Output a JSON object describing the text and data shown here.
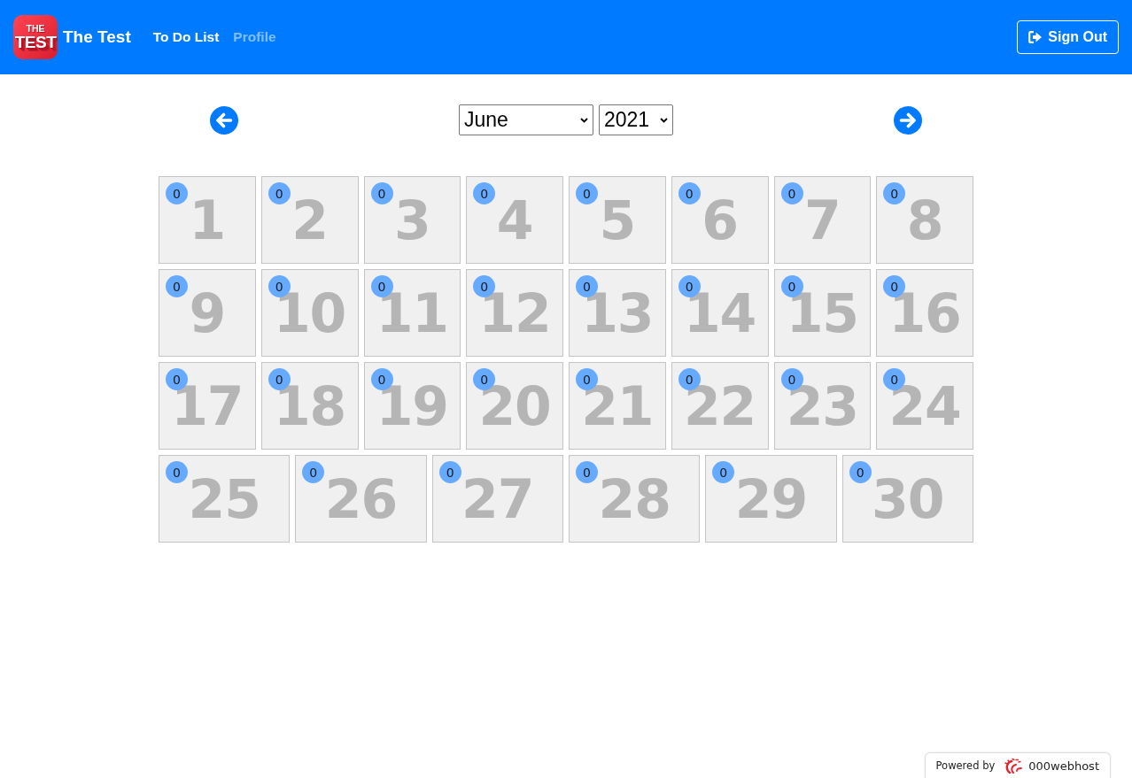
{
  "navbar": {
    "logo": {
      "top_text": "THE",
      "bottom_text": "TEST"
    },
    "title": "The Test",
    "links": [
      {
        "label": "To Do List",
        "selected": true
      },
      {
        "label": "Profile",
        "selected": false
      }
    ],
    "sign_out_button": {
      "label": "Sign Out"
    }
  },
  "month_nav": {
    "month_select": {
      "value": "June"
    },
    "year_select": {
      "value": "2021"
    }
  },
  "days": [
    {
      "day": "1",
      "count": "0"
    },
    {
      "day": "2",
      "count": "0"
    },
    {
      "day": "3",
      "count": "0"
    },
    {
      "day": "4",
      "count": "0"
    },
    {
      "day": "5",
      "count": "0"
    },
    {
      "day": "6",
      "count": "0"
    },
    {
      "day": "7",
      "count": "0"
    },
    {
      "day": "8",
      "count": "0"
    },
    {
      "day": "9",
      "count": "0"
    },
    {
      "day": "10",
      "count": "0"
    },
    {
      "day": "11",
      "count": "0"
    },
    {
      "day": "12",
      "count": "0"
    },
    {
      "day": "13",
      "count": "0"
    },
    {
      "day": "14",
      "count": "0"
    },
    {
      "day": "15",
      "count": "0"
    },
    {
      "day": "16",
      "count": "0"
    },
    {
      "day": "17",
      "count": "0"
    },
    {
      "day": "18",
      "count": "0"
    },
    {
      "day": "19",
      "count": "0"
    },
    {
      "day": "20",
      "count": "0"
    },
    {
      "day": "21",
      "count": "0"
    },
    {
      "day": "22",
      "count": "0"
    },
    {
      "day": "23",
      "count": "0"
    },
    {
      "day": "24",
      "count": "0"
    },
    {
      "day": "25",
      "count": "0"
    },
    {
      "day": "26",
      "count": "0"
    },
    {
      "day": "27",
      "count": "0"
    },
    {
      "day": "28",
      "count": "0"
    },
    {
      "day": "29",
      "count": "0"
    },
    {
      "day": "30",
      "count": "0"
    }
  ],
  "footer": {
    "powered_by": "Powered by",
    "host": "000webhost"
  }
}
